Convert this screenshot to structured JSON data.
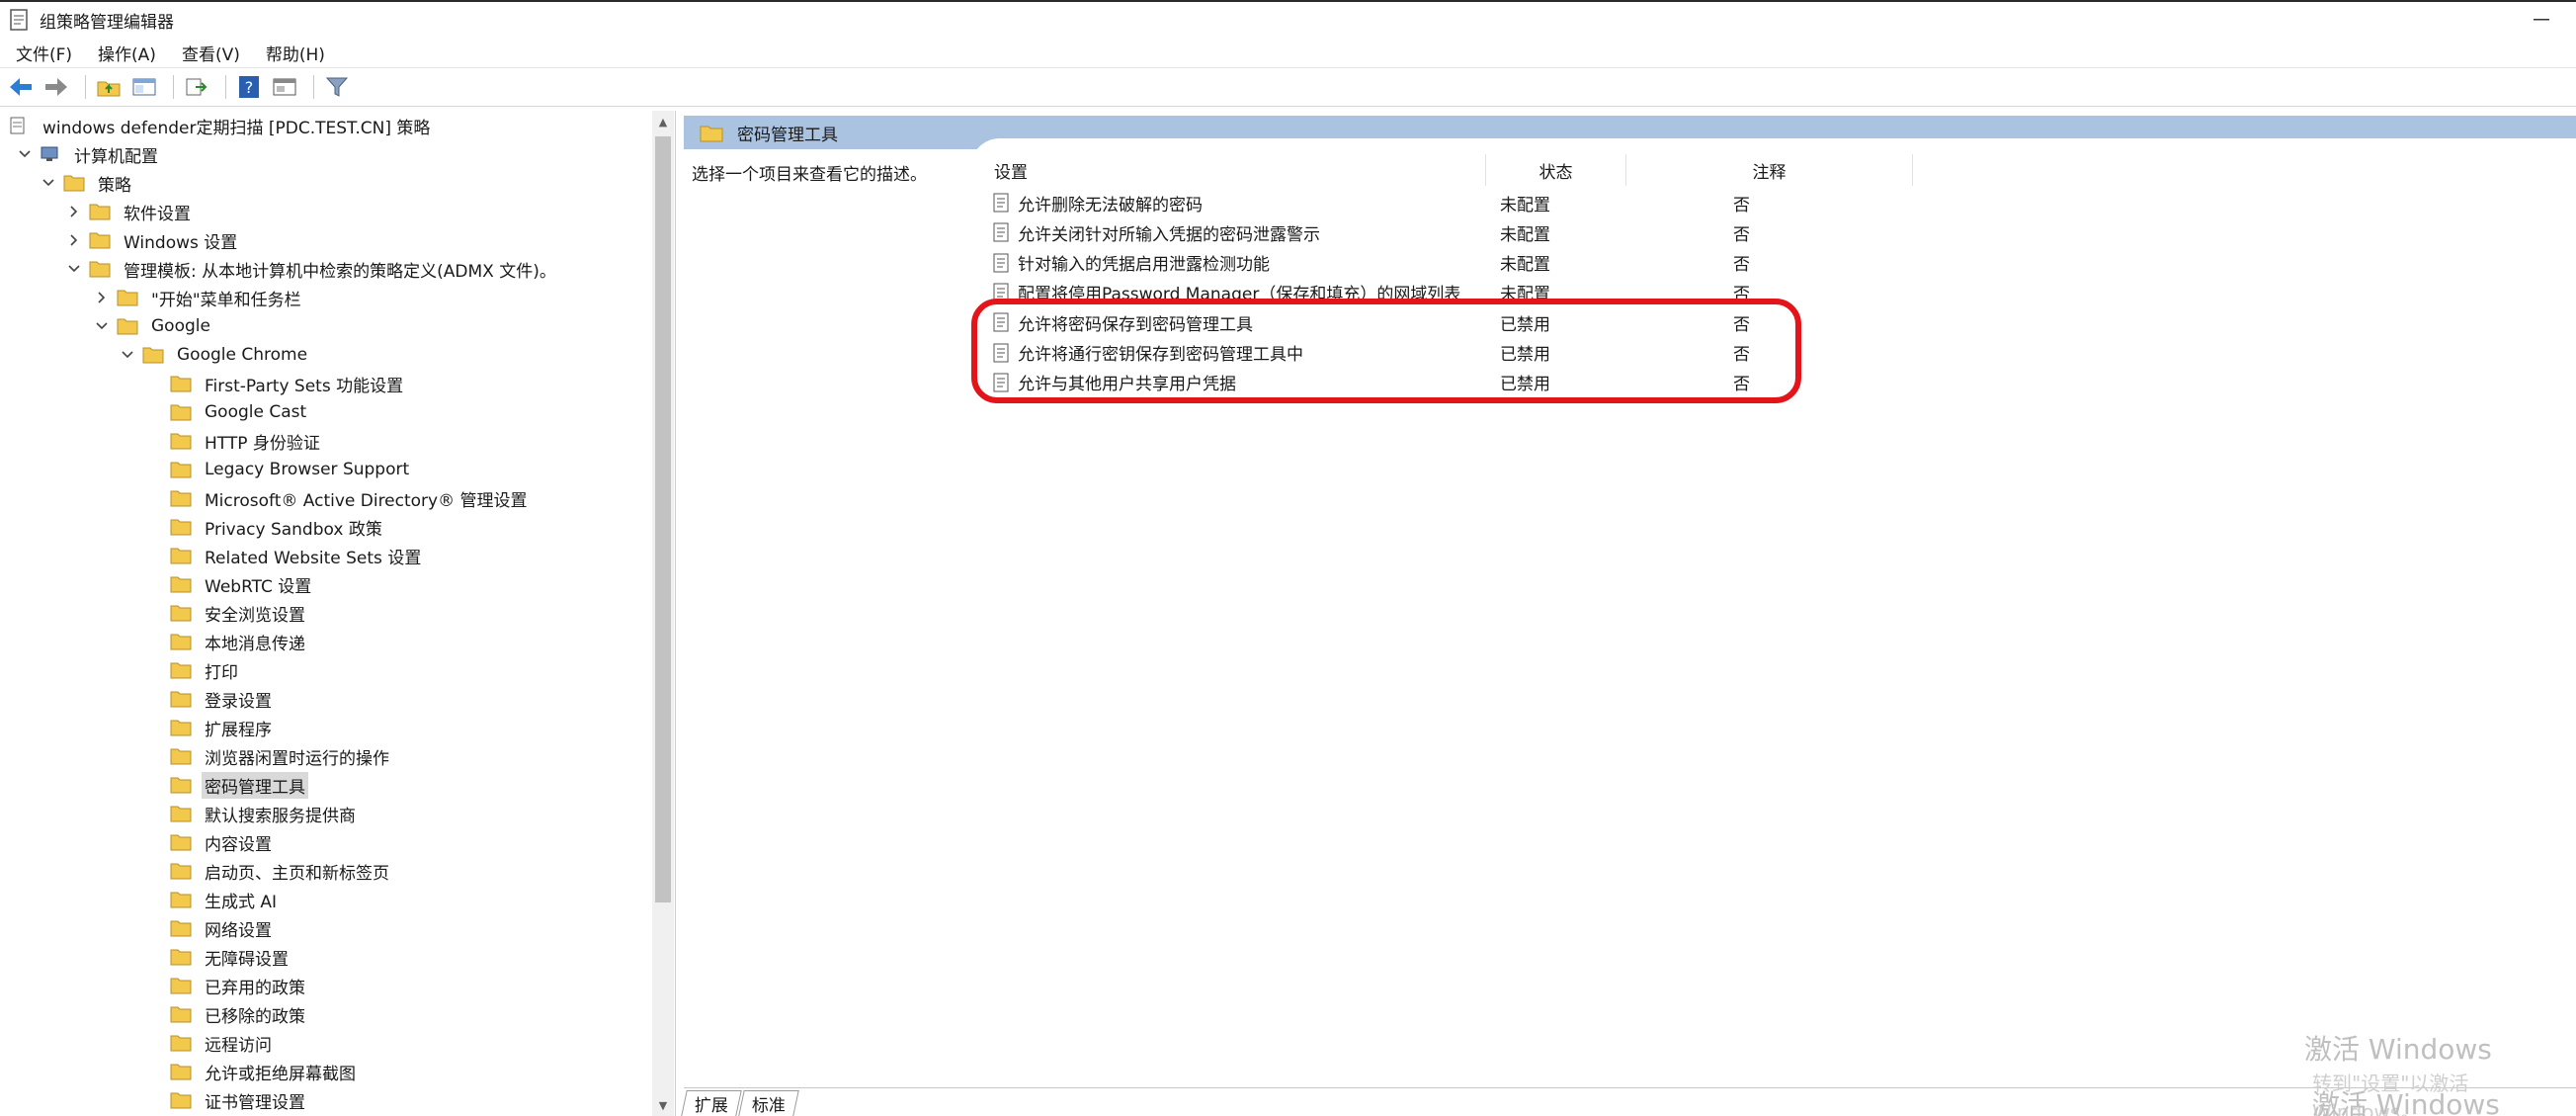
{
  "window": {
    "title": "组策略管理编辑器",
    "app_icon": "gpedit-icon",
    "min_icon": "minimize-icon"
  },
  "menu": [
    "文件(F)",
    "操作(A)",
    "查看(V)",
    "帮助(H)"
  ],
  "toolbar": {
    "icons": [
      "back-arrow-icon",
      "forward-arrow-icon",
      "up-folder-icon",
      "show-hide-tree-icon",
      "export-list-icon",
      "help-icon",
      "properties-icon",
      "filter-icon"
    ]
  },
  "tree": {
    "root": "windows defender定期扫描 [PDC.TEST.CN] 策略",
    "computer_config": "计算机配置",
    "policies": "策略",
    "software_settings": "软件设置",
    "windows_settings": "Windows 设置",
    "admin_templates": "管理模板: 从本地计算机中检索的策略定义(ADMX 文件)。",
    "start_menu": "\"开始\"菜单和任务栏",
    "google": "Google",
    "google_chrome": "Google Chrome",
    "chrome_children": [
      "First-Party Sets 功能设置",
      "Google Cast",
      "HTTP 身份验证",
      "Legacy Browser Support",
      "Microsoft® Active Directory® 管理设置",
      "Privacy Sandbox 政策",
      "Related Website Sets 设置",
      "WebRTC 设置",
      "安全浏览设置",
      "本地消息传递",
      "打印",
      "登录设置",
      "扩展程序",
      "浏览器闲置时运行的操作",
      "密码管理工具",
      "默认搜索服务提供商",
      "内容设置",
      "启动页、主页和新标签页",
      "生成式 AI",
      "网络设置",
      "无障碍设置",
      "已弃用的政策",
      "已移除的政策",
      "远程访问",
      "允许或拒绝屏幕截图",
      "证书管理设置"
    ],
    "selected_index": 14
  },
  "right": {
    "header_title": "密码管理工具",
    "description": "选择一个项目来查看它的描述。",
    "columns": {
      "setting": "设置",
      "state": "状态",
      "note": "注释"
    },
    "rows": [
      {
        "name": "允许删除无法破解的密码",
        "state": "未配置",
        "note": "否"
      },
      {
        "name": "允许关闭针对所输入凭据的密码泄露警示",
        "state": "未配置",
        "note": "否"
      },
      {
        "name": "针对输入的凭据启用泄露检测功能",
        "state": "未配置",
        "note": "否"
      },
      {
        "name": "配置将停用Password Manager（保存和填充）的网域列表",
        "state": "未配置",
        "note": "否"
      },
      {
        "name": "允许将密码保存到密码管理工具",
        "state": "已禁用",
        "note": "否"
      },
      {
        "name": "允许将通行密钥保存到密码管理工具中",
        "state": "已禁用",
        "note": "否"
      },
      {
        "name": "允许与其他用户共享用户凭据",
        "state": "已禁用",
        "note": "否"
      }
    ],
    "highlight_color": "#e3151b"
  },
  "tabs": [
    "扩展",
    "标准"
  ],
  "watermark": {
    "line1": "激活 Windows",
    "line2": "转到\"设置\"以激活 Windows。",
    "line3": "激活 Windows"
  },
  "colors": {
    "header_band": "#a9c3e0",
    "folder": "#f2c94c",
    "selection": "#d9d9d9"
  }
}
